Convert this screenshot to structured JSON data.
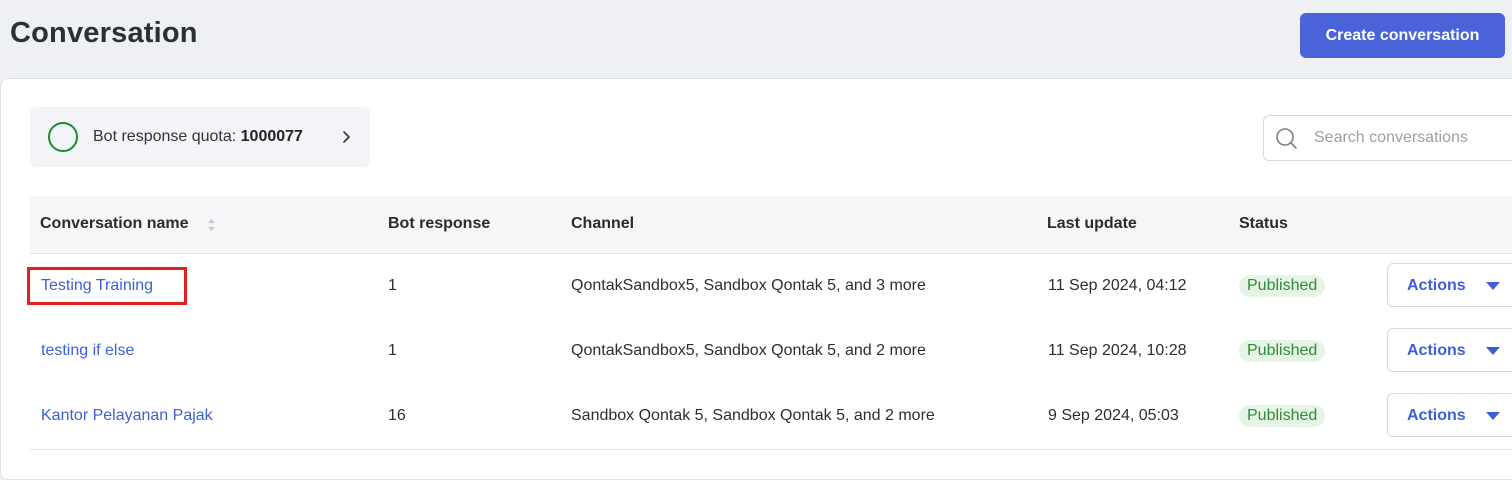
{
  "header": {
    "title": "Conversation",
    "create_button": "Create conversation"
  },
  "quota": {
    "label": "Bot response quota: ",
    "value": "1000077",
    "ring_color": "#1f8a2a"
  },
  "search": {
    "placeholder": "Search conversations"
  },
  "table": {
    "columns": [
      "Conversation name",
      "Bot response",
      "Channel",
      "Last update",
      "Status"
    ],
    "rows": [
      {
        "name": "Testing Training",
        "bot_response": "1",
        "channel": "QontakSandbox5, Sandbox Qontak 5, and 3 more",
        "last_update": "11 Sep 2024, 04:12",
        "status": "Published",
        "actions": "Actions",
        "highlighted": true
      },
      {
        "name": "testing if else",
        "bot_response": "1",
        "channel": "QontakSandbox5, Sandbox Qontak 5, and 2 more",
        "last_update": "11 Sep 2024, 10:28",
        "status": "Published",
        "actions": "Actions"
      },
      {
        "name": "Kantor Pelayanan Pajak",
        "bot_response": "16",
        "channel": "Sandbox Qontak 5, Sandbox Qontak 5, and 2 more",
        "last_update": "9 Sep 2024, 05:03",
        "status": "Published",
        "actions": "Actions"
      }
    ]
  },
  "colors": {
    "accent": "#4b63d8",
    "link": "#3d5fd6",
    "published_bg": "#e6f4e6",
    "published_text": "#2f8a3a",
    "highlight": "#e0211d"
  }
}
